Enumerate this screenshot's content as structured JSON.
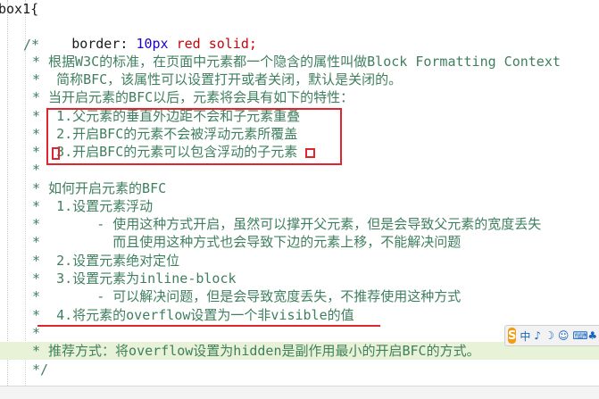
{
  "editor": {
    "lines": [
      {
        "selector": "box1{"
      },
      {
        "prop": "border",
        "value_num": "10px",
        "value_rest": " red solid;"
      },
      {
        "text": "/*"
      },
      {
        "text": "* 根据W3C的标准，在页面中元素都一个隐含的属性叫做Block Formatting Context"
      },
      {
        "text": "*  简称BFC，该属性可以设置打开或者关闭，默认是关闭的。"
      },
      {
        "text": "* 当开启元素的BFC以后，元素将会具有如下的特性："
      },
      {
        "text": "*  1.父元素的垂直外边距不会和子元素重叠"
      },
      {
        "text": "*  2.开启BFC的元素不会被浮动元素所覆盖"
      },
      {
        "text": "*  3.开启BFC的元素可以包含浮动的子元素"
      },
      {
        "text": "*"
      },
      {
        "text": "* 如何开启元素的BFC"
      },
      {
        "text": "*  1.设置元素浮动"
      },
      {
        "text": "*       - 使用这种方式开启，虽然可以撑开父元素，但是会导致父元素的宽度丢失"
      },
      {
        "text": "*         而且使用这种方式也会导致下边的元素上移，不能解决问题"
      },
      {
        "text": "*  2.设置元素绝对定位"
      },
      {
        "text": "*  3.设置元素为inline-block"
      },
      {
        "text": "*       - 可以解决问题，但是会导致宽度丢失，不推荐使用这种方式"
      },
      {
        "text": "*  4.将元素的overflow设置为一个非visible的值"
      },
      {
        "text": "*"
      },
      {
        "text": "* 推荐方式：将overflow设置为hidden是副作用最小的开启BFC的方式。"
      },
      {
        "text": "*/"
      }
    ]
  },
  "ime": {
    "logo": "S",
    "items": [
      "中",
      "♪",
      "☽",
      "☺",
      "⌨",
      "♣",
      "⊞"
    ]
  },
  "colors": {
    "comment": "#3f7f5f",
    "keyword": "#1a1a1a",
    "value": "#c5060b",
    "annotation": "#e0252e",
    "highlight_line": "#e8f2d6"
  }
}
